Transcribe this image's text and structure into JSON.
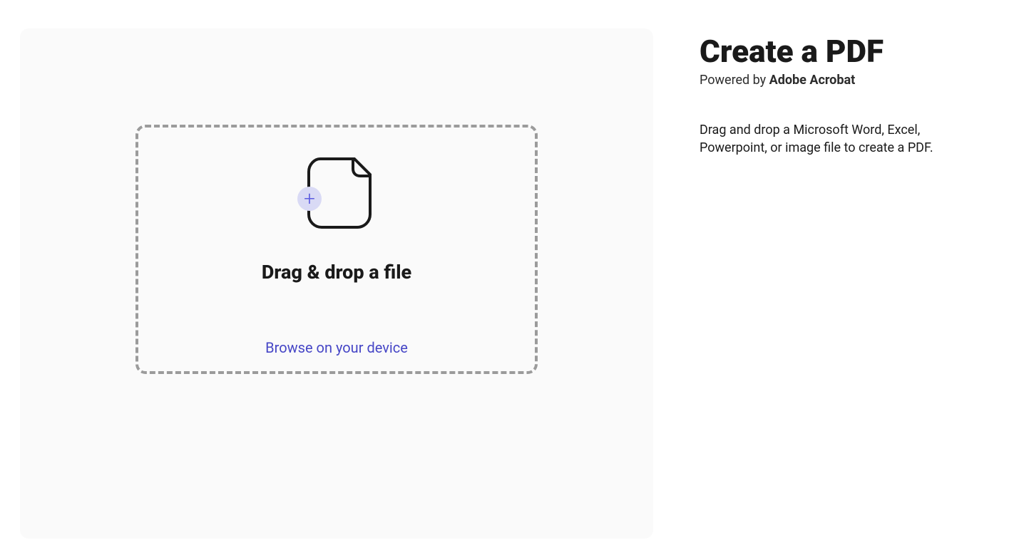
{
  "dropzone": {
    "title": "Drag & drop a file",
    "browse_link": "Browse on your device"
  },
  "sidebar": {
    "title": "Create a PDF",
    "subtitle_prefix": "Powered by ",
    "subtitle_brand": "Adobe Acrobat",
    "description": "Drag and drop a Microsoft Word, Excel, Powerpoint, or image file to create a PDF."
  }
}
